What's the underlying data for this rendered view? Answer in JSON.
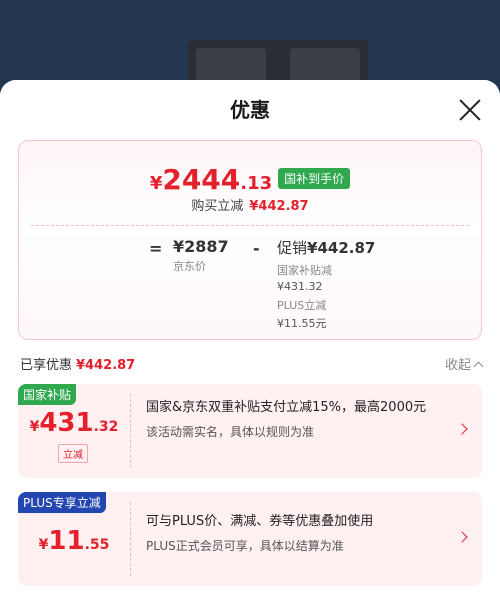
{
  "sheet": {
    "title": "优惠"
  },
  "summary": {
    "final_currency": "¥",
    "final_int": "2444",
    "final_dec": ".13",
    "subsidy_tag": "国补到手价",
    "discount_label": "购买立减",
    "discount_amount": "¥442.87",
    "equals": "=",
    "jd_price": "¥2887",
    "jd_label": "京东价",
    "minus": "-",
    "promo_label": "促销",
    "promo_amount": "¥442.87",
    "national_label": "国家补贴减",
    "national_amount": "¥431.32",
    "plus_label": "PLUS立减",
    "plus_amount": "¥11.55元"
  },
  "enjoyed": {
    "label": "已享优惠",
    "amount": "¥442.87",
    "collapse": "收起"
  },
  "coupons": [
    {
      "tag": "国家补贴",
      "currency": "¥",
      "int": "431",
      "dec": ".32",
      "badge": "立减",
      "title": "国家&京东双重补贴支付立减15%，最高2000元",
      "note": "该活动需实名，具体以规则为准"
    },
    {
      "tag": "PLUS专享立减",
      "currency": "¥",
      "int": "11",
      "dec": ".55",
      "title": "可与PLUS价、满减、券等优惠叠加使用",
      "note": "PLUS正式会员可享，具体以结算为准"
    }
  ],
  "icons": {
    "close": "close-icon",
    "collapse": "chevron-up-icon",
    "coupon_arrow": "chevron-right-icon"
  },
  "colors": {
    "accent_red": "#e3202b",
    "subsidy_green": "#2fa84f",
    "plus_blue": "#2346b0"
  }
}
